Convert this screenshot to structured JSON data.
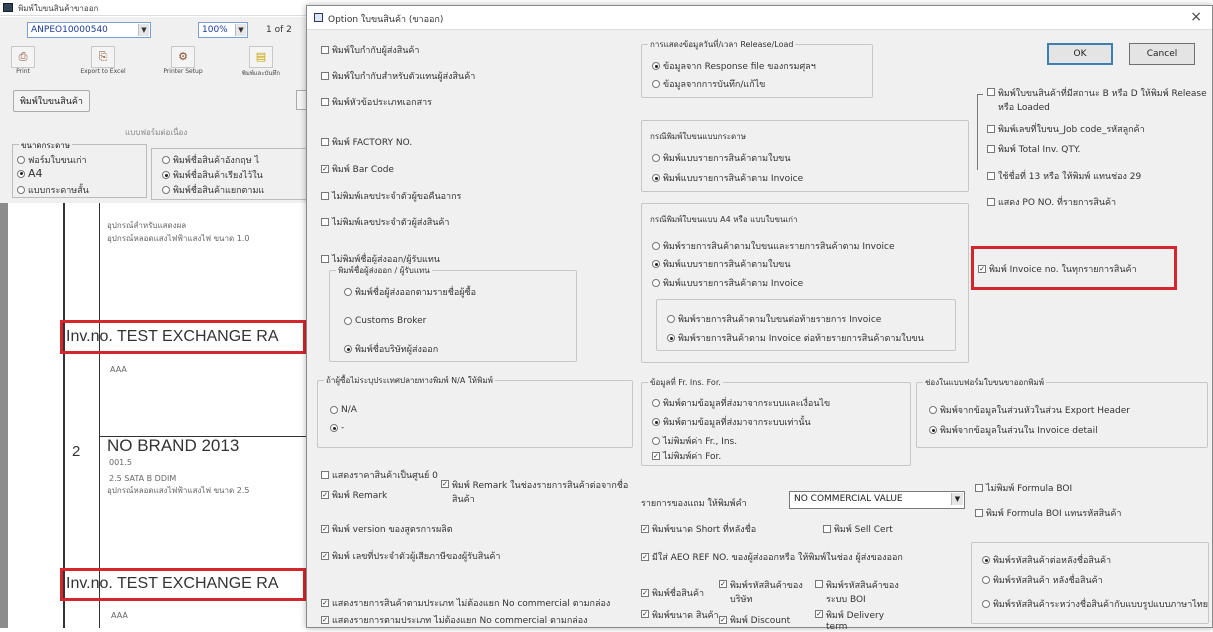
{
  "viewer": {
    "title": "พิมพ์ใบขนสินค้าขาออก",
    "report_combo": "ANPEO10000540",
    "zoom": "100%",
    "page_info": "1 of 2",
    "toolbar": [
      {
        "label": "Print",
        "icon": "printer-icon"
      },
      {
        "label": "Export to Excel",
        "icon": "export-icon"
      },
      {
        "label": "Printer Setup",
        "icon": "printer-setup-icon"
      },
      {
        "label": "พิมพ์และบันทึก",
        "icon": "print-save-icon"
      }
    ],
    "print_button": "พิมพ์ใบขนสินค้า",
    "paper_status": "แบบฟอร์มต่อเนื่อง",
    "paper_group": {
      "title": "ขนาดกระดาษ",
      "options": [
        {
          "label": "ฟอร์มใบขนเก่า",
          "selected": false
        },
        {
          "label": "A4",
          "selected": true
        },
        {
          "label": "แบบกระดาษสั้น",
          "selected": false
        }
      ]
    },
    "print_mode_options": [
      {
        "label": "พิมพ์ชื่อสินค้าอังกฤษ ไ",
        "selected": false
      },
      {
        "label": "พิมพ์ชื่อสินค้าเรียงไว้ใน",
        "selected": true
      },
      {
        "label": "พิมพ์ชื่อสินค้าแยกตามแ",
        "selected": false
      }
    ],
    "report": {
      "row1_desc1": "อุปกรณ์สำหรับแสดงผล",
      "row1_desc2": "อุปกรณ์หลอดแสงไฟฟ้าแสงไฟ ขนาด 1.0",
      "inv_line_1": "Inv.no. TEST EXCHANGE RA",
      "row1_brand_note": "AAA",
      "row2_no": "2",
      "row2_brand": "NO BRAND 2013",
      "row2_code": "001.5",
      "row2_desc1": "2.5 SATA B DDIM",
      "row2_desc2": "อุปกรณ์หลอดแสงไฟฟ้าแสงไฟ ขนาด 2.5",
      "inv_line_2": "Inv.no. TEST EXCHANGE RA",
      "row2_brand_note": "AAA"
    }
  },
  "dialog": {
    "title": "Option ใบขนสินค้า (ขาออก)",
    "ok_label": "OK",
    "cancel_label": "Cancel",
    "col1_checkboxes": [
      {
        "label": "พิมพ์ใบกำกับผู้ส่งสินค้า",
        "checked": false
      },
      {
        "label": "พิมพ์ใบกำกับสำหรับตัวแทนผู้ส่งสินค้า",
        "checked": false
      },
      {
        "label": "พิมพ์หัวข้อประเภทเอกสาร",
        "checked": false
      },
      {
        "label": "พิมพ์ FACTORY NO.",
        "checked": false
      },
      {
        "label": "พิมพ์ Bar Code",
        "checked": true
      },
      {
        "label": "ไม่พิมพ์เลขประจำตัวผู้ขอคืนอากร",
        "checked": false
      },
      {
        "label": "ไม่พิมพ์เลขประจำตัวผู้ส่งสินค้า",
        "checked": false
      },
      {
        "label": "ไม่พิมพ์ชื่อผู้ส่งออก/ผู้รับแทน",
        "checked": false
      }
    ],
    "col1_group": {
      "title": "พิมพ์ชื่อผู้ส่งออก / ผู้รับแทน",
      "options": [
        {
          "label": "พิมพ์ชื่อผู้ส่งออกตามรายชื่อผู้ซื้อ",
          "selected": false
        },
        {
          "label": "Customs Broker",
          "selected": false
        },
        {
          "label": "พิมพ์ชื่อบริษัทผู้ส่งออก",
          "selected": true
        }
      ]
    },
    "na_group": {
      "title": "ถ้าผู้ซื้อไม่ระบุประเทศปลายทางพิมพ์ N/A ให้พิมพ์",
      "options": [
        {
          "label": "N/A",
          "selected": false
        },
        {
          "label": "-",
          "selected": true
        }
      ]
    },
    "col1_bottom": [
      {
        "label": "แสดงราคาสินค้าเป็นศูนย์ 0",
        "checked": false
      },
      {
        "label": "พิมพ์ Remark",
        "checked": true
      },
      {
        "label": "พิมพ์ version ของสูตรการผลิต",
        "checked": true
      },
      {
        "label": "พิมพ์ เลขที่ประจำตัวผู้เสียภาษีของผู้รับสินค้า",
        "checked": true
      },
      {
        "label": "แสดงรายการสินค้าตามประเภท ไม่ต้องแยก No commercial ตามกล่อง",
        "checked": true
      },
      {
        "label": "แสดงรายการตามประเภท ไม่ต้องแยก No commercial ตามกล่อง",
        "checked": true
      }
    ],
    "remark_extra": {
      "label": "พิมพ์ Remark ในช่องรายการสินค้าต่อจากชื่อสินค้า",
      "checked": true
    },
    "release_group": {
      "title": "การแสดงข้อมูลวันที่/เวลา Release/Load",
      "options": [
        {
          "label": "ข้อมูลจาก Response file ของกรมศุลฯ",
          "selected": true
        },
        {
          "label": "ข้อมูลจากการบันทึก/แก้ไข",
          "selected": false
        }
      ]
    },
    "box_group": {
      "title": "กรณีพิมพ์ใบขนแบบกระดาษ",
      "options": [
        {
          "label": "พิมพ์แบบรายการสินค้าตามใบขน",
          "selected": false
        },
        {
          "label": "พิมพ์แบบรายการสินค้าตาม Invoice",
          "selected": true
        }
      ]
    },
    "a4_group": {
      "title": "กรณีพิมพ์ใบขนแบบ A4 หรือ แบบใบขนเก่า",
      "options": [
        {
          "label": "พิมพ์รายการสินค้าตามใบขนและรายการสินค้าตาม Invoice",
          "selected": false
        },
        {
          "label": "พิมพ์แบบรายการสินค้าตามใบขน",
          "selected": true
        },
        {
          "label": "พิมพ์แบบรายการสินค้าตาม Invoice",
          "selected": false
        }
      ]
    },
    "a4_subgroup": [
      {
        "label": "พิมพ์รายการสินค้าตามใบขนต่อท้ายรายการ Invoice",
        "selected": false
      },
      {
        "label": "พิมพ์รายการสินค้าตาม Invoice ต่อท้ายรายการสินค้าตามใบขน",
        "selected": true
      }
    ],
    "fri_group": {
      "title": "ข้อมูลที่ Fr. Ins. For.",
      "options": [
        {
          "label": "พิมพ์ตามข้อมูลที่ส่งมาจากระบบและเงื่อนไข",
          "selected": false
        },
        {
          "label": "พิมพ์ตามข้อมูลที่ส่งมาจากระบบเท่านั้น",
          "selected": true
        },
        {
          "label": "ไม่พิมพ์ค่า Fr., Ins.",
          "selected": false
        }
      ],
      "checkbox": {
        "label": "ไม่พิมพ์ค่า For.",
        "checked": true
      }
    },
    "export_group": {
      "title": "ช่องในแบบฟอร์มใบขนขาออกพิมพ์",
      "options": [
        {
          "label": "พิมพ์จากข้อมูลในส่วนหัวในส่วน Export Header",
          "selected": false
        },
        {
          "label": "พิมพ์จากข้อมูลในส่วนใน Invoice detail",
          "selected": true
        }
      ]
    },
    "no_comm": {
      "label": "รายการของแถม ให้พิมพ์คำ",
      "value": "NO COMMERCIAL VALUE"
    },
    "col2_checks": [
      {
        "label": "พิมพ์ขนาด Short ที่หลังชื่อ",
        "checked": true
      },
      {
        "label": "พิมพ์ Sell Cert",
        "checked": false
      },
      {
        "label": "มีใส่ AEO REF NO. ของผู้ส่งออกหรือ ให้พิมพ์ในช่อง ผู้ส่งของออก",
        "checked": true
      },
      {
        "label": "พิมพ์ชื่อสินค้า",
        "checked": true
      },
      {
        "label": "พิมพ์รหัสสินค้าของบริษัท",
        "checked": true
      },
      {
        "label": "พิมพ์รหัสสินค้าของ ระบบ BOI",
        "checked": false
      },
      {
        "label": "พิมพ์ขนาด สินค้า",
        "checked": true
      },
      {
        "label": "พิมพ์ Discount",
        "checked": true
      },
      {
        "label": "พิมพ์ Delivery term",
        "checked": true
      }
    ],
    "col3_checks": [
      {
        "label": "พิมพ์ใบขนสินค้าที่มีสถานะ B หรือ D ให้พิมพ์ Release หรือ Loaded",
        "checked": false
      },
      {
        "label": "พิมพ์เลขที่ใบขน_Job code_รหัสลูกค้า",
        "checked": false
      },
      {
        "label": "พิมพ์ Total Inv. QTY.",
        "checked": false
      },
      {
        "label": "ใช้ชื่อที่ 13 หรือ ให้พิมพ์ แทนช่อง 29",
        "checked": false
      },
      {
        "label": "แสดง PO NO. ที่รายการสินค้า",
        "checked": false
      },
      {
        "label": "พิมพ์ Invoice no. ในทุกรายการสินค้า",
        "checked": true
      },
      {
        "label": "ไม่พิมพ์ Formula BOI",
        "checked": false
      },
      {
        "label": "พิมพ์ Formula BOI แทนรหัสสินค้า",
        "checked": false
      }
    ],
    "name_group": [
      {
        "label": "พิมพ์รหัสสินค้าต่อหลังชื่อสินค้า",
        "selected": true
      },
      {
        "label": "พิมพ์รหัสสินค้า หลังชื่อสินค้า",
        "selected": false
      },
      {
        "label": "พิมพ์รหัสสินค้าระหว่างชื่อสินค้ากับแบบรูปแบบภาษาไทย",
        "selected": false
      }
    ]
  }
}
